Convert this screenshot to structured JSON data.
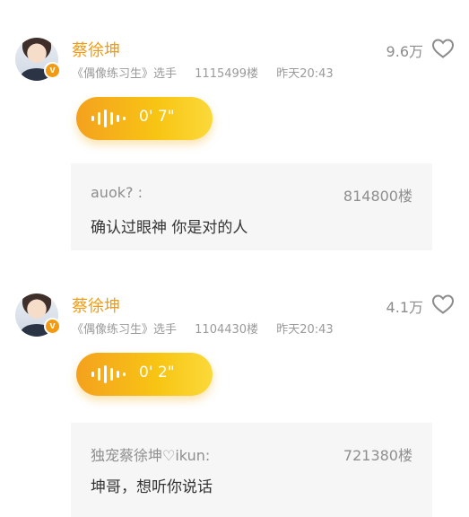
{
  "posts": [
    {
      "author": "蔡徐坤",
      "badge": "v",
      "role": "《偶像练习生》选手",
      "floor": "1115499楼",
      "time": "昨天20:43",
      "likes": "9.6万",
      "voice_duration": "0' 7\"",
      "quote": {
        "user": "auok? :",
        "floor": "814800楼",
        "text": "确认过眼神 你是对的人"
      }
    },
    {
      "author": "蔡徐坤",
      "badge": "v",
      "role": "《偶像练习生》选手",
      "floor": "1104430楼",
      "time": "昨天20:43",
      "likes": "4.1万",
      "voice_duration": "0' 2\"",
      "quote": {
        "user": "独宠蔡徐坤♡ikun:",
        "floor": "721380楼",
        "text": "坤哥，想听你说话"
      }
    }
  ],
  "icons": {
    "like": "heart-outline-icon",
    "voice": "sound-wave-icon",
    "verified": "verified-badge-icon"
  },
  "colors": {
    "accent": "#f29b12",
    "voice_gradient_start": "#f4a11e",
    "voice_gradient_end": "#fbd93a",
    "quote_bg": "#f6f6f6"
  }
}
